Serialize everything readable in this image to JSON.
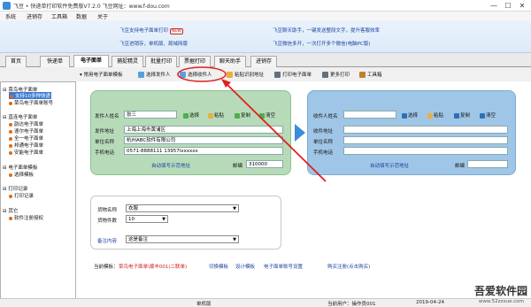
{
  "window": {
    "title": "飞豆 • 快递单打印软件免费版V7.2.0   飞豆网址：www.f-dou.com",
    "controls": {
      "minimize": "—",
      "maximize": "☐",
      "close": "✕"
    }
  },
  "menu": [
    "系统",
    "进销存",
    "工具箱",
    "数据",
    "关于"
  ],
  "banner": {
    "left": [
      "飞豆支持电子面单打印",
      "飞豆进销存，单机版、局域网版"
    ],
    "right": [
      "飞豆聊天助手，一键发送整段文字，提升客服效率",
      "飞豆微信多开，一次打开多个微信(电脑PC版)"
    ],
    "new_badge": "NEW"
  },
  "tabs": [
    "首页",
    "快递单",
    "电子面单",
    "捕捉精灵",
    "批量打印",
    "票据打印",
    "聊天助手",
    "进销存"
  ],
  "active_tab": "电子面单",
  "toolbar": {
    "template_label": "常用电子面单模板",
    "buttons": [
      "选择发件人",
      "选择收件人",
      "粘贴识别地址",
      "打印电子面单",
      "更多打印",
      "工具箱"
    ]
  },
  "tree": {
    "groups": [
      {
        "title": "菜鸟电子面单",
        "items": [
          "支持10多种快递",
          "菜鸟电子面单账号"
        ]
      },
      {
        "title": "直连电子面单",
        "items": [
          "韵达电子面单",
          "速尔电子面单",
          "全一电子面单",
          "邦通电子面单",
          "安能电子面单"
        ]
      },
      {
        "title": "电子面单模板",
        "items": [
          "选择模板"
        ]
      },
      {
        "title": "打印记录",
        "items": [
          "打印记录"
        ]
      },
      {
        "title": "其它",
        "items": [
          "软件注册授权"
        ]
      }
    ]
  },
  "sender": {
    "name_label": "发件人姓名",
    "name_value": "张三",
    "address_label": "发件地址",
    "address_value": "上海上海市黄浦区",
    "company_label": "单位名称",
    "company_value": "杭州ABC软件有限公司",
    "phone_label": "手机电话",
    "phone_value": "0571-8888111  13957lxxxxxx",
    "auto_link": "自动填写示范地址",
    "zip_label": "邮编",
    "zip_value": "310000",
    "actions": [
      "选择",
      "粘贴",
      "复制",
      "清空"
    ]
  },
  "receiver": {
    "name_label": "收件人姓名",
    "address_label": "收件地址",
    "company_label": "单位名称",
    "phone_label": "手机电话",
    "auto_link": "自动填写示范地址",
    "zip_label": "邮编",
    "actions": [
      "选择",
      "粘贴",
      "复制",
      "清空"
    ]
  },
  "goods": {
    "name_label": "货物名称",
    "name_value": "衣服",
    "count_label": "货物件数",
    "count_value": "10",
    "remark_label": "备注内容",
    "remark_value": "这是备注"
  },
  "footer": {
    "current_label": "当前模板：",
    "current_template": "菜鸟电子面单\\顺丰001(二联单)",
    "links": [
      "切换模板",
      "设计模板",
      "电子面单账号设置",
      "购买注册(点击购买)"
    ]
  },
  "status": {
    "edition": "单机版",
    "user": "当前用户：操作员001",
    "date": "2019-04-24"
  },
  "watermark": {
    "title": "吾爱软件园",
    "url": "www.52zzxue.com"
  },
  "colors": {
    "sender_box": "#b7dbb8",
    "receiver_box": "#9fc6e7",
    "accent": "#3a7bd5",
    "annotation": "#e02020"
  }
}
